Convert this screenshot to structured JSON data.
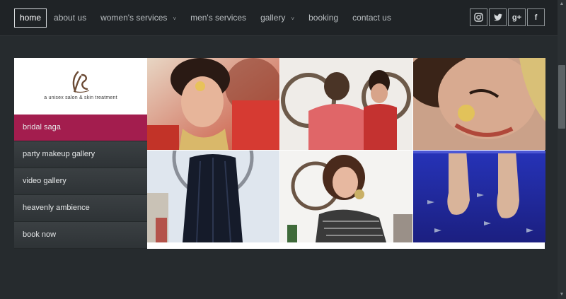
{
  "nav": {
    "items": [
      {
        "label": "home",
        "active": true
      },
      {
        "label": "about us"
      },
      {
        "label": "women's services",
        "dropdown": true
      },
      {
        "label": "men's services"
      },
      {
        "label": "gallery",
        "dropdown": true
      },
      {
        "label": "booking"
      },
      {
        "label": "contact us"
      }
    ],
    "caret": "˅"
  },
  "social": [
    {
      "icon": "instagram-icon",
      "glyph": "◎"
    },
    {
      "icon": "twitter-icon",
      "glyph": "❧"
    },
    {
      "icon": "google-plus-icon",
      "glyph": "g+"
    },
    {
      "icon": "facebook-icon",
      "glyph": "f"
    }
  ],
  "logo": {
    "tagline": "a unisex salon & skin treatment"
  },
  "side_menu": [
    {
      "label": "bridal saga",
      "active": true
    },
    {
      "label": "party makeup gallery"
    },
    {
      "label": "video gallery"
    },
    {
      "label": "heavenly ambience"
    },
    {
      "label": "book now"
    }
  ],
  "gallery": [
    {
      "name": "bridal-portrait-photo"
    },
    {
      "name": "stylist-with-bride-photo"
    },
    {
      "name": "bridal-closeup-photo"
    },
    {
      "name": "long-hair-styling-photo"
    },
    {
      "name": "party-makeup-model-photo"
    },
    {
      "name": "fish-pedicure-photo"
    }
  ],
  "colors": {
    "accent": "#a31d4e",
    "background": "#262b2e",
    "nav": "#1f2326"
  }
}
